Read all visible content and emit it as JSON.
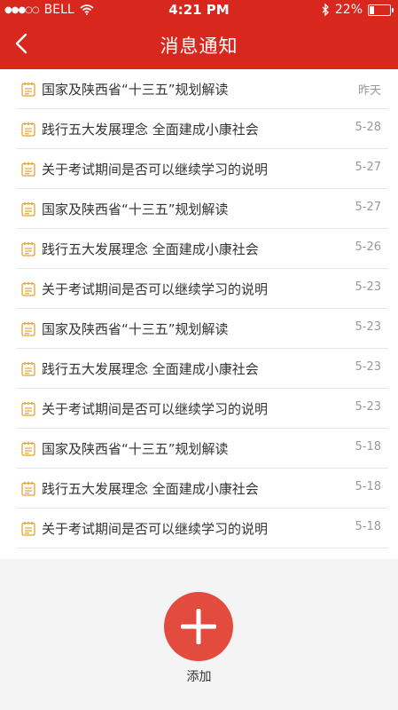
{
  "status_bar": {
    "signal_dots": "●●●○○",
    "carrier": "BELL",
    "time": "4:21 PM",
    "battery_text": "22%",
    "battery_level": 0.22,
    "icons": [
      "wifi-icon",
      "bluetooth-icon",
      "battery-icon"
    ]
  },
  "header": {
    "title": "消息通知",
    "back_icon": "chevron-left-icon"
  },
  "messages": [
    {
      "title": "国家及陕西省“十三五”规划解读",
      "date": "昨天"
    },
    {
      "title": "践行五大发展理念 全面建成小康社会",
      "date": "5-28"
    },
    {
      "title": "关于考试期间是否可以继续学习的说明",
      "date": "5-27"
    },
    {
      "title": "国家及陕西省“十三五”规划解读",
      "date": "5-27"
    },
    {
      "title": "践行五大发展理念 全面建成小康社会",
      "date": "5-26"
    },
    {
      "title": "关于考试期间是否可以继续学习的说明",
      "date": "5-23"
    },
    {
      "title": "国家及陕西省“十三五”规划解读",
      "date": "5-23"
    },
    {
      "title": "践行五大发展理念 全面建成小康社会",
      "date": "5-23"
    },
    {
      "title": "关于考试期间是否可以继续学习的说明",
      "date": "5-23"
    },
    {
      "title": "国家及陕西省“十三五”规划解读",
      "date": "5-18"
    },
    {
      "title": "践行五大发展理念 全面建成小康社会",
      "date": "5-18"
    },
    {
      "title": "关于考试期间是否可以继续学习的说明",
      "date": "5-18"
    }
  ],
  "add_button": {
    "label": "添加",
    "icon": "plus-icon"
  },
  "colors": {
    "header": "#d8271d",
    "fab": "#e44b3f",
    "note_icon": "#e8a23a",
    "date_text": "#999999"
  }
}
